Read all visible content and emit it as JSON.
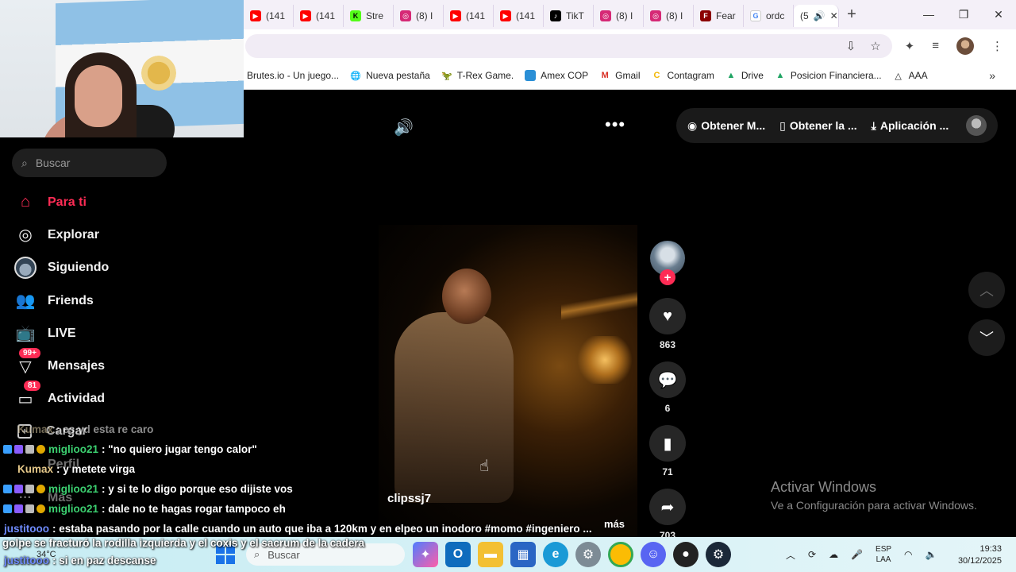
{
  "browser": {
    "tabs": [
      {
        "label": "(141",
        "icon": "youtube-icon",
        "color": "#ff0000"
      },
      {
        "label": "(141",
        "icon": "youtube-icon",
        "color": "#ff0000"
      },
      {
        "label": "Stre",
        "icon": "kick-icon",
        "color": "#53fc18"
      },
      {
        "label": "(8) I",
        "icon": "instagram-icon",
        "color": "#d62976"
      },
      {
        "label": "(141",
        "icon": "youtube-icon",
        "color": "#ff0000"
      },
      {
        "label": "(141",
        "icon": "youtube-icon",
        "color": "#ff0000"
      },
      {
        "label": "TikT",
        "icon": "tiktok-icon",
        "color": "#000000"
      },
      {
        "label": "(8) I",
        "icon": "instagram-icon",
        "color": "#d62976"
      },
      {
        "label": "(8) I",
        "icon": "instagram-icon",
        "color": "#d62976"
      },
      {
        "label": "Fear",
        "icon": "fear-icon",
        "color": "#8b0000"
      },
      {
        "label": "ordc",
        "icon": "google-icon",
        "color": "#4285f4"
      },
      {
        "label": "(5",
        "icon": "tiktok-icon",
        "color": "#000000"
      }
    ],
    "bookmarks": [
      {
        "label": "Brutes.io - Un juego...",
        "icon": ""
      },
      {
        "label": "Nueva pestaña",
        "icon": "globe-icon"
      },
      {
        "label": "T-Rex Game.",
        "icon": "dino-icon"
      },
      {
        "label": "Amex COP",
        "icon": "amex-icon"
      },
      {
        "label": "Gmail",
        "icon": "gmail-icon"
      },
      {
        "label": "Contagram",
        "icon": "contagram-icon"
      },
      {
        "label": "Drive",
        "icon": "drive-icon"
      },
      {
        "label": "Posicion Financiera...",
        "icon": "drive-icon"
      },
      {
        "label": "AAA",
        "icon": "aaa-icon"
      }
    ]
  },
  "sidebar": {
    "search_placeholder": "Buscar",
    "items": [
      {
        "label": "Para ti",
        "icon": "home-icon",
        "active": true
      },
      {
        "label": "Explorar",
        "icon": "compass-icon"
      },
      {
        "label": "Siguiendo",
        "icon": "following-avatar-icon"
      },
      {
        "label": "Friends",
        "icon": "friends-icon"
      },
      {
        "label": "LIVE",
        "icon": "live-icon"
      },
      {
        "label": "Mensajes",
        "icon": "messages-icon",
        "badge": "99+"
      },
      {
        "label": "Actividad",
        "icon": "activity-icon",
        "badge": "81"
      },
      {
        "label": "Cargar",
        "icon": "upload-icon"
      },
      {
        "label": "Perfil",
        "icon": "profile-icon"
      },
      {
        "label": "Más",
        "icon": "more-icon"
      }
    ]
  },
  "topbar": {
    "get_coins": "Obtener M...",
    "get_app": "Obtener la ...",
    "desktop_app": "Aplicación ..."
  },
  "video": {
    "username": "clipssj7",
    "more_label": "más",
    "likes": "863",
    "comments": "6",
    "saves": "71",
    "shares": "703"
  },
  "windows_activation": {
    "title": "Activar Windows",
    "subtitle": "Ve a Configuración para activar Windows."
  },
  "chat": [
    {
      "user": "Kumax",
      "text": ": es yd esta re caro",
      "user_color": "#d8c7a0",
      "badges": false,
      "dim": true
    },
    {
      "user": "miglioo21",
      "text": ": \"no quiero jugar tengo calor\"",
      "user_color": "#3cd070",
      "badges": true
    },
    {
      "user": "Kumax",
      "text": ": y metete virga",
      "user_color": "#e6c98a",
      "badges": false
    },
    {
      "user": "miglioo21",
      "text": ": y si te lo digo porque eso dijiste vos",
      "user_color": "#3cd070",
      "badges": true
    },
    {
      "user": "miglioo21",
      "text": ": dale no te hagas rogar tampoco eh",
      "user_color": "#3cd070",
      "badges": true
    },
    {
      "user": "justitooo",
      "text": ": estaba pasando por la calle cuando un auto que iba a 120km y en el",
      "user_color": "#6f8cff",
      "badges": false
    },
    {
      "user": "",
      "text": "golpe se fracturó la rodilla izquierda y el coxis y el sacrum de la cadera",
      "user_color": "#ffffff",
      "badges": false
    },
    {
      "user": "justitooo",
      "text": ": si en paz descanse",
      "user_color": "#6f8cff",
      "badges": false
    }
  ],
  "video_desc_tail": "peo un inodoro #momo #ingeniero ...",
  "taskbar": {
    "weather_temp": "34°C",
    "search_placeholder": "Buscar",
    "lang_line1": "ESP",
    "lang_line2": "LAA",
    "time": "19:33",
    "date": "30/12/2025"
  }
}
